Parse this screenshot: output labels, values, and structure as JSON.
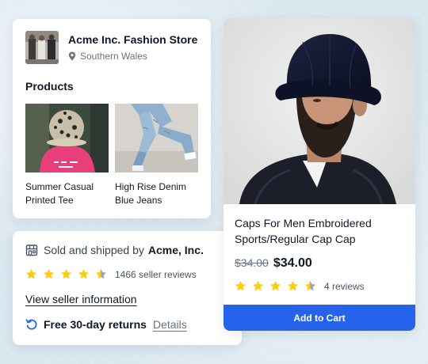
{
  "store": {
    "name": "Acme Inc. Fashion Store",
    "location": "Southern Wales",
    "products_title": "Products",
    "products": [
      {
        "name": "Summer Casual Printed Tee"
      },
      {
        "name": "High Rise Denim Blue Jeans"
      }
    ]
  },
  "seller": {
    "sold_label": "Sold and shipped by",
    "seller_name": "Acme, Inc.",
    "rating": 4.5,
    "reviews": "1466 seller reviews",
    "view_link": "View seller information",
    "returns_text": "Free 30-day returns",
    "details_link": "Details"
  },
  "product": {
    "title": "Caps For Men Embroidered Sports/Regular Cap Cap",
    "old_price": "$34.00",
    "price": "$34.00",
    "rating": 4.5,
    "reviews": "4 reviews",
    "cta": "Add to Cart"
  },
  "colors": {
    "star": "#facc15",
    "star_empty": "#9ca3af",
    "button": "#2563eb",
    "returns_icon": "#2563eb"
  }
}
